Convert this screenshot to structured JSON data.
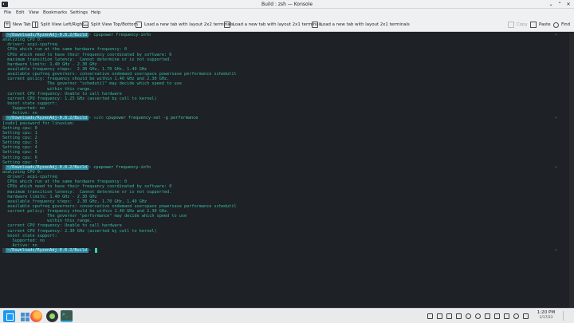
{
  "window": {
    "title": "Build : zsh — Konsole",
    "controls": [
      "⌄",
      "⌃",
      "✕"
    ]
  },
  "menubar": [
    "File",
    "Edit",
    "View",
    "Bookmarks",
    "Settings",
    "Help"
  ],
  "toolbar": {
    "new_tab": "New Tab",
    "split_lr": "Split View Left/Right",
    "split_tb": "Split View Top/Bottom",
    "layout_2x2": "Load a new tab with layout 2x2 terminals",
    "layout_2x1": "Load a new tab with layout 2x1 terminals",
    "layout_2x1b": "Load a new tab with layout 2x1 terminals",
    "copy": "Copy",
    "paste": "Paste",
    "find": "Find"
  },
  "prompt": {
    "os_glyph": "",
    "path": "~/Downloads/RyzenAdj-0.8.2/Build",
    "arrow": ">"
  },
  "terminal": {
    "lines": [
      {
        "type": "prompt",
        "sudo": "",
        "cmd": "cpupower frequency-info"
      },
      {
        "type": "text",
        "text": "analyzing CPU 0:"
      },
      {
        "type": "text",
        "text": "  driver: acpi-cpufreq"
      },
      {
        "type": "text",
        "text": "  CPUs which run at the same hardware frequency: 0"
      },
      {
        "type": "text",
        "text": "  CPUs which need to have their frequency coordinated by software: 0"
      },
      {
        "type": "text",
        "text": "  maximum transition latency:  Cannot determine or is not supported."
      },
      {
        "type": "text",
        "text": "  hardware limits: 1.40 GHz - 2.30 GHz"
      },
      {
        "type": "text",
        "text": "  available frequency steps:  2.30 GHz, 1.70 GHz, 1.40 GHz"
      },
      {
        "type": "text",
        "text": "  available cpufreq governors: conservative ondemand userspace powersave performance schedutil"
      },
      {
        "type": "text",
        "text": "  current policy: frequency should be within 1.40 GHz and 2.30 GHz."
      },
      {
        "type": "text",
        "text": "                  The governor \"schedutil\" may decide which speed to use"
      },
      {
        "type": "text",
        "text": "                  within this range."
      },
      {
        "type": "text",
        "text": "  current CPU frequency: Unable to call hardware"
      },
      {
        "type": "text",
        "text": "  current CPU frequency: 1.25 GHz (asserted by call to kernel)"
      },
      {
        "type": "text",
        "text": "  boost state support:"
      },
      {
        "type": "text",
        "text": "    Supported: no"
      },
      {
        "type": "text",
        "text": "    Active: no"
      },
      {
        "type": "prompt",
        "sudo": "sudo",
        "cmd": "cpupower frequency-set -g performance"
      },
      {
        "type": "text",
        "text": "[sudo] password for linuxium:"
      },
      {
        "type": "text",
        "text": "Setting cpu: 0"
      },
      {
        "type": "text",
        "text": "Setting cpu: 1"
      },
      {
        "type": "text",
        "text": "Setting cpu: 2"
      },
      {
        "type": "text",
        "text": "Setting cpu: 3"
      },
      {
        "type": "text",
        "text": "Setting cpu: 4"
      },
      {
        "type": "text",
        "text": "Setting cpu: 5"
      },
      {
        "type": "text",
        "text": "Setting cpu: 6"
      },
      {
        "type": "text",
        "text": "Setting cpu: 7"
      },
      {
        "type": "prompt",
        "sudo": "",
        "cmd": "cpupower frequency-info"
      },
      {
        "type": "text",
        "text": "analyzing CPU 0:"
      },
      {
        "type": "text",
        "text": "  driver: acpi-cpufreq"
      },
      {
        "type": "text",
        "text": "  CPUs which run at the same hardware frequency: 0"
      },
      {
        "type": "text",
        "text": "  CPUs which need to have their frequency coordinated by software: 0"
      },
      {
        "type": "text",
        "text": "  maximum transition latency:  Cannot determine or is not supported."
      },
      {
        "type": "text",
        "text": "  hardware limits: 1.40 GHz - 2.30 GHz"
      },
      {
        "type": "text",
        "text": "  available frequency steps:  2.30 GHz, 1.70 GHz, 1.40 GHz"
      },
      {
        "type": "text",
        "text": "  available cpufreq governors: conservative ondemand userspace powersave performance schedutil"
      },
      {
        "type": "text",
        "text": "  current policy: frequency should be within 1.40 GHz and 2.30 GHz."
      },
      {
        "type": "text",
        "text": "                  The governor \"performance\" may decide which speed to use"
      },
      {
        "type": "text",
        "text": "                  within this range."
      },
      {
        "type": "text",
        "text": "  current CPU frequency: Unable to call hardware"
      },
      {
        "type": "text",
        "text": "  current CPU frequency: 2.30 GHz (asserted by call to kernel)"
      },
      {
        "type": "text",
        "text": "  boost state support:"
      },
      {
        "type": "text",
        "text": "    Supported: no"
      },
      {
        "type": "text",
        "text": "    Active: no"
      },
      {
        "type": "prompt",
        "sudo": "",
        "cmd": "",
        "cursor": true
      }
    ],
    "right_mark": "⏎"
  },
  "taskbar": {
    "clock_time": "1:20 PM",
    "clock_date": "1/17/23"
  },
  "colors": {
    "terminal_bg": "#1e2125",
    "terminal_fg": "#35b9a6",
    "prompt_dir_bg": "#2a8aa0",
    "chrome_bg": "#eff0f1"
  }
}
